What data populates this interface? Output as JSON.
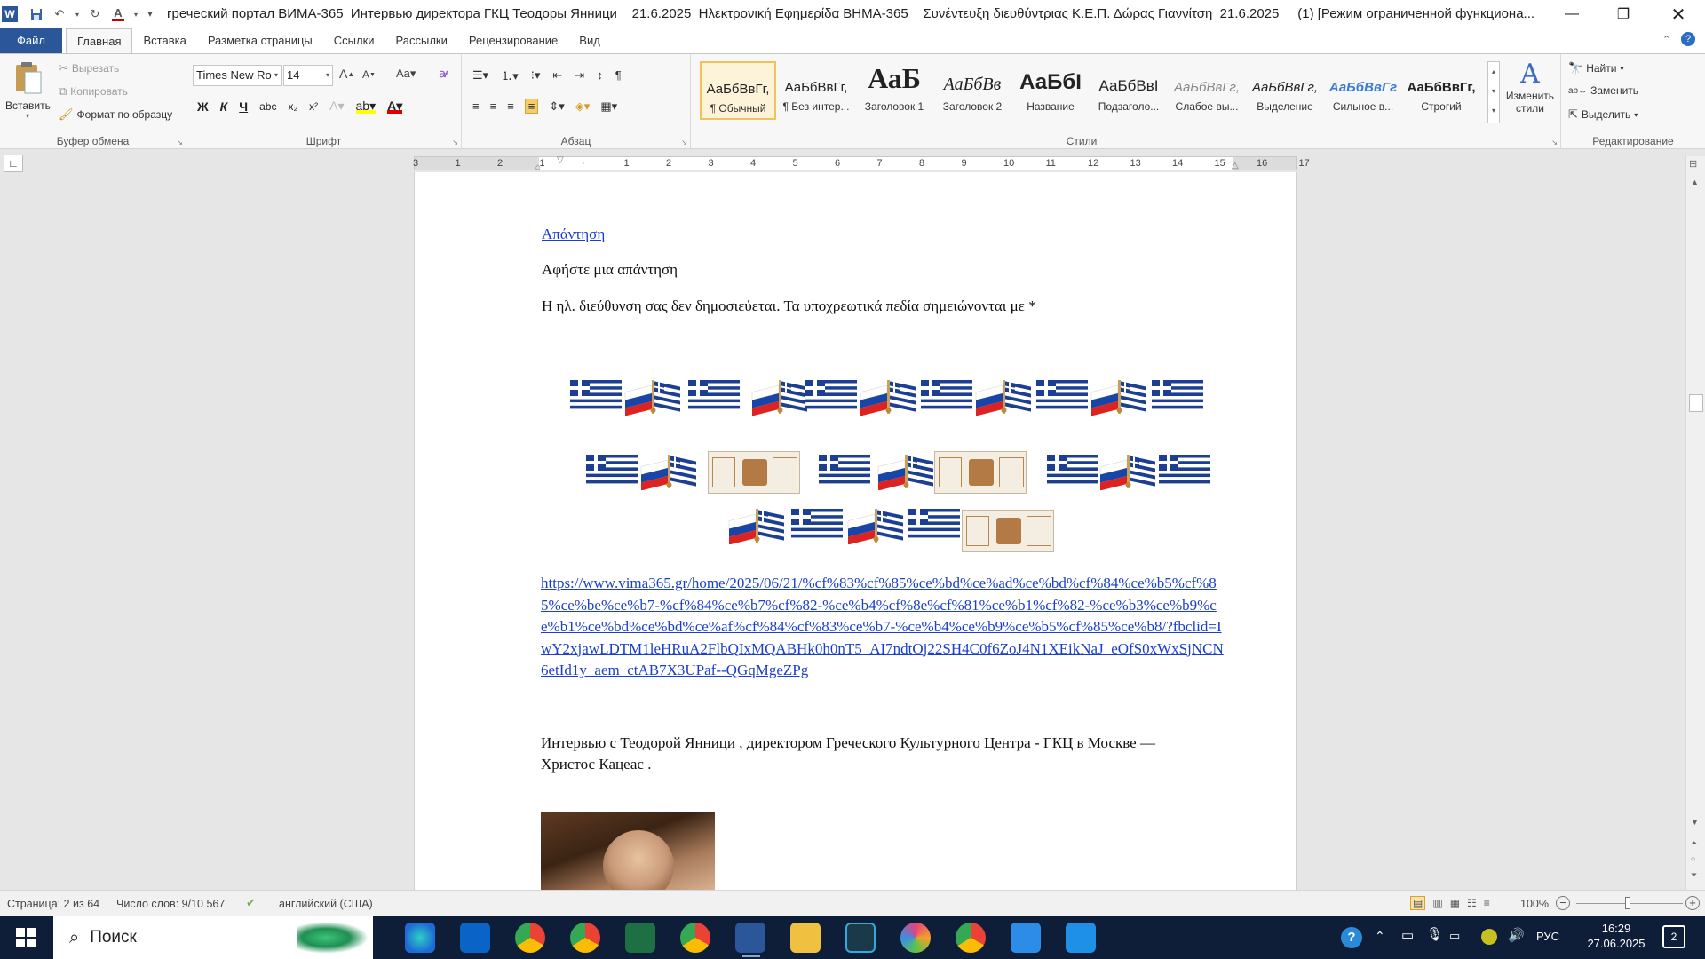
{
  "window": {
    "title": "греческий портал ВИМА-365_Интервью директора ГКЦ Теодоры Янници__21.6.2025_Ηλεκτρονική Εφημερίδα ΒΗΜΑ-365__Συνέντευξη διευθύντριας Κ.Ε.Π. Δώρας Γιαννίτση_21.6.2025__ (1) [Режим ограниченной функциона..."
  },
  "tabs": [
    "Файл",
    "Главная",
    "Вставка",
    "Разметка страницы",
    "Ссылки",
    "Рассылки",
    "Рецензирование",
    "Вид"
  ],
  "ribbon": {
    "clipboard": {
      "paste": "Вставить",
      "cut": "Вырезать",
      "copy": "Копировать",
      "format_painter": "Формат по образцу",
      "label": "Буфер обмена"
    },
    "font": {
      "name": "Times New Ro",
      "size": "14",
      "label": "Шрифт"
    },
    "paragraph": {
      "label": "Абзац"
    },
    "styles": {
      "label": "Стили",
      "items": [
        {
          "preview": "АаБбВвГг,",
          "name": "¶ Обычный"
        },
        {
          "preview": "АаБбВвГг,",
          "name": "¶ Без интер..."
        },
        {
          "preview": "АаБ",
          "name": "Заголовок 1"
        },
        {
          "preview": "АаБбВв",
          "name": "Заголовок 2"
        },
        {
          "preview": "АаБбІ",
          "name": "Название"
        },
        {
          "preview": "АаБбВвI",
          "name": "Подзаголо..."
        },
        {
          "preview": "АаБбВвГг,",
          "name": "Слабое вы..."
        },
        {
          "preview": "АаБбВвГг,",
          "name": "Выделение"
        },
        {
          "preview": "АаБбВвГг",
          "name": "Сильное в..."
        },
        {
          "preview": "АаБбВвГг,",
          "name": "Строгий"
        }
      ],
      "change": "Изменить стили"
    },
    "editing": {
      "find": "Найти",
      "replace": "Заменить",
      "select": "Выделить",
      "label": "Редактирование"
    }
  },
  "ruler": {
    "ticks": [
      "3",
      "1",
      "2",
      "1",
      "",
      "1",
      "2",
      "3",
      "4",
      "5",
      "6",
      "7",
      "8",
      "9",
      "10",
      "11",
      "12",
      "13",
      "14",
      "15",
      "16",
      "17"
    ]
  },
  "document": {
    "reply_link": "Απάντηση",
    "leave_reply": "Αφήστε μια απάντηση",
    "email_note": "Η ηλ. διεύθυνση σας δεν δημοσιεύεται. Τα υποχρεωτικά πεδία σημειώνονται με *",
    "url": "https://www.vima365.gr/home/2025/06/21/%cf%83%cf%85%ce%bd%ce%ad%ce%bd%cf%84%ce%b5%cf%85%ce%be%ce%b7-%cf%84%ce%b7%cf%82-%ce%b4%cf%8e%cf%81%ce%b1%cf%82-%ce%b3%ce%b9%ce%b1%ce%bd%ce%bd%ce%af%cf%84%cf%83%ce%b7-%ce%b4%ce%b9%ce%b5%cf%85%ce%b8/?fbclid=IwY2xjawLDTM1leHRuA2FlbQIxMQABHk0h0nT5_AI7ndtOj22SH4C0f6ZoJ4N1XEikNaJ_eOfS0xWxSjNCN6etId1y_aem_ctAB7X3UPaf--QGqMgeZPg",
    "interview_line1": "Интервью с Теодорой Янници , директором Греческого  Культурного Центра -  ГКЦ в Москве —",
    "interview_line2": "Христос Кацеас ."
  },
  "statusbar": {
    "page": "Страница: 2 из 64",
    "words": "Число слов: 9/10 567",
    "language": "английский (США)",
    "zoom": "100%"
  },
  "taskbar": {
    "search": "Поиск",
    "lang": "РУС",
    "time": "16:29",
    "date": "27.06.2025",
    "notifications": "2"
  }
}
